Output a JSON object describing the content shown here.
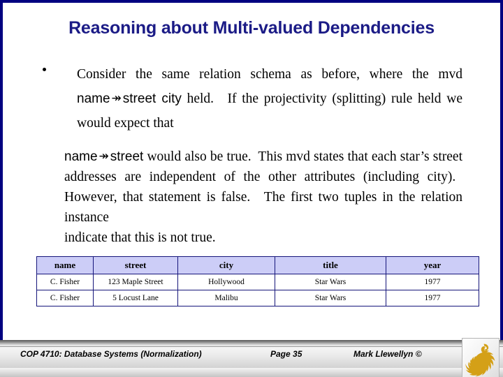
{
  "slide": {
    "title": "Reasoning about Multi-valued Dependencies",
    "title_color": "#1b1b86",
    "frame_color": "#000080",
    "background": "#ffffff"
  },
  "body": {
    "bullet_glyph": "•",
    "paragraph1": {
      "part1": "Consider the same relation schema as before, where the mvd ",
      "attr_left": "name",
      "arrow": "↠",
      "attr_right": "street city",
      "part2": " held. If the projectivity (splitting) rule held we would expect that"
    },
    "paragraph2": {
      "attr_left": "name",
      "arrow": "↠",
      "attr_right": "street",
      "part1": " would also be true. This mvd states that each star’s street addresses are independent of the other attributes (including city). However, that statement is false. The first two tuples in the relation instance",
      "lastline": "indicate that this is not true."
    }
  },
  "table": {
    "header_bg": "#cccdf7",
    "border_color": "#15157a",
    "columns": [
      "name",
      "street",
      "city",
      "title",
      "year"
    ],
    "rows": [
      {
        "name": "C. Fisher",
        "street": "123 Maple Street",
        "city": "Hollywood",
        "title": "Star Wars",
        "year": "1977"
      },
      {
        "name": "C. Fisher",
        "street": "5 Locust Lane",
        "city": "Malibu",
        "title": "Star Wars",
        "year": "1977"
      }
    ]
  },
  "footer": {
    "course": "COP 4710: Database Systems  (Normalization)",
    "page": "Page 35",
    "author": "Mark Llewellyn ©",
    "logo_name": "ucf-pegasus-logo",
    "logo_color": "#d4a017"
  }
}
